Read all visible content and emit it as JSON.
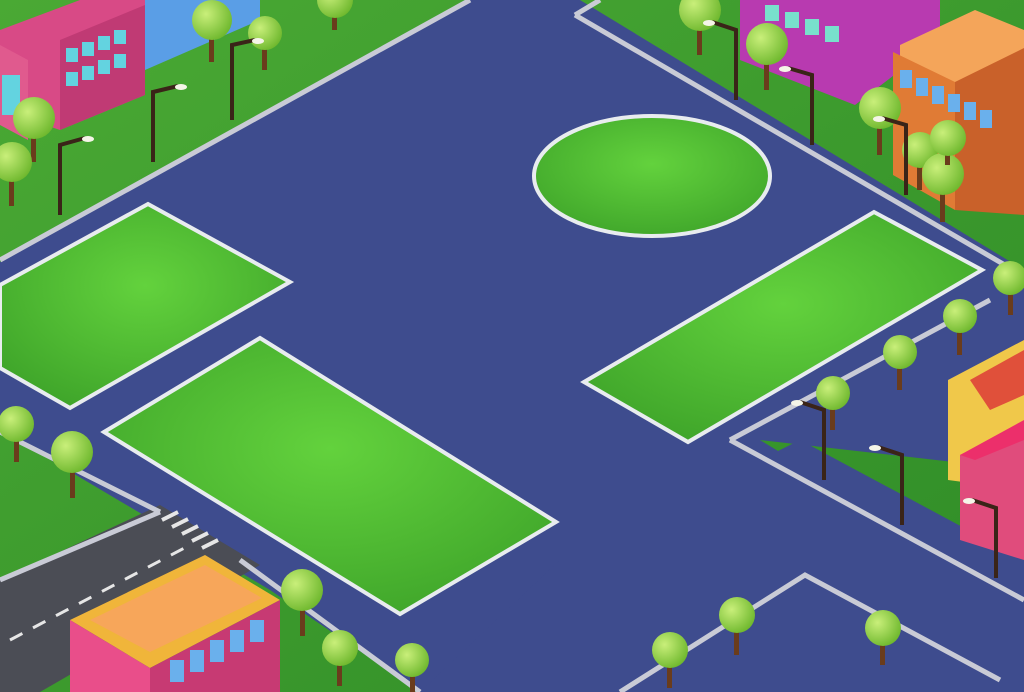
{
  "scene": {
    "kind": "isometric city map",
    "colors": {
      "grass": "#3f9a2f",
      "grass_light": "#58c83a",
      "asphalt": "#3c4a8c",
      "curb": "#c9cbd6",
      "plot_fill": "#5fd03a",
      "plot_edge": "#e8ecef",
      "lamp_post": "#3a2418",
      "tree_crown": "#8fd244",
      "tree_trunk": "#6a3c1c"
    },
    "building_palette": [
      "#d84a86",
      "#5a9ee6",
      "#b83ab0",
      "#e07b35",
      "#f0b53a",
      "#e04c7c",
      "#ec2f6b"
    ],
    "plots": [
      {
        "id": "plot-oval",
        "shape": "ellipse"
      },
      {
        "id": "plot-left-upper",
        "shape": "parallelogram"
      },
      {
        "id": "plot-left-lower",
        "shape": "parallelogram"
      },
      {
        "id": "plot-right",
        "shape": "parallelogram"
      }
    ]
  }
}
